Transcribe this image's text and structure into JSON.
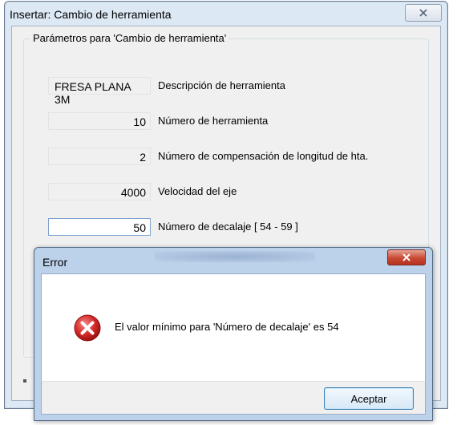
{
  "main_window": {
    "title": "Insertar: Cambio de herramienta",
    "group_label": "Parámetros para 'Cambio de herramienta'",
    "fields": [
      {
        "value": "FRESA PLANA 3M",
        "label": "Descripción de herramienta"
      },
      {
        "value": "10",
        "label": "Número de herramienta"
      },
      {
        "value": "2",
        "label": "Número de compensación de longitud de hta."
      },
      {
        "value": "4000",
        "label": "Velocidad del eje"
      },
      {
        "value": "50",
        "label": "Número de decalaje  [ 54 - 59 ]"
      }
    ]
  },
  "error_dialog": {
    "title": "Error",
    "message": "El valor mínimo para 'Número de decalaje' es 54",
    "ok_label": "Aceptar"
  },
  "colors": {
    "error_icon": "#d42a2a",
    "close_button_red": "#c84a35"
  }
}
